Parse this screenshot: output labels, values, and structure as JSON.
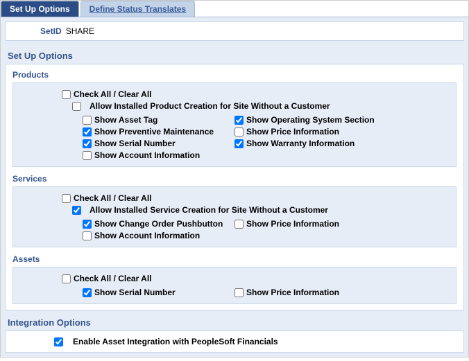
{
  "tabs": {
    "active": "Set Up Options",
    "inactive": "Define Status Translates"
  },
  "header": {
    "setid_label": "SetID",
    "setid_value": "SHARE"
  },
  "section_title": "Set Up Options",
  "products": {
    "title": "Products",
    "check_all": {
      "label": "Check All / Clear All",
      "checked": false
    },
    "allow_creation": {
      "label": "Allow Installed Product Creation for Site Without a Customer",
      "checked": false
    },
    "left": [
      {
        "label": "Show Asset Tag",
        "checked": false
      },
      {
        "label": "Show Preventive Maintenance",
        "checked": true
      },
      {
        "label": "Show Serial Number",
        "checked": true
      },
      {
        "label": "Show Account Information",
        "checked": false
      }
    ],
    "right": [
      {
        "label": "Show Operating System Section",
        "checked": true
      },
      {
        "label": "Show Price Information",
        "checked": false
      },
      {
        "label": "Show Warranty Information",
        "checked": true
      }
    ]
  },
  "services": {
    "title": "Services",
    "check_all": {
      "label": "Check All / Clear All",
      "checked": false
    },
    "allow_creation": {
      "label": "Allow Installed Service Creation for Site Without a Customer",
      "checked": true
    },
    "left": [
      {
        "label": "Show Change Order Pushbutton",
        "checked": true
      },
      {
        "label": "Show Account Information",
        "checked": false
      }
    ],
    "right": [
      {
        "label": "Show Price Information",
        "checked": false
      }
    ]
  },
  "assets": {
    "title": "Assets",
    "check_all": {
      "label": "Check All / Clear All",
      "checked": false
    },
    "left": [
      {
        "label": "Show Serial Number",
        "checked": true
      }
    ],
    "right": [
      {
        "label": "Show Price Information",
        "checked": false
      }
    ]
  },
  "integration": {
    "title": "Integration Options",
    "enable": {
      "label": "Enable Asset Integration with PeopleSoft Financials",
      "checked": true
    }
  }
}
